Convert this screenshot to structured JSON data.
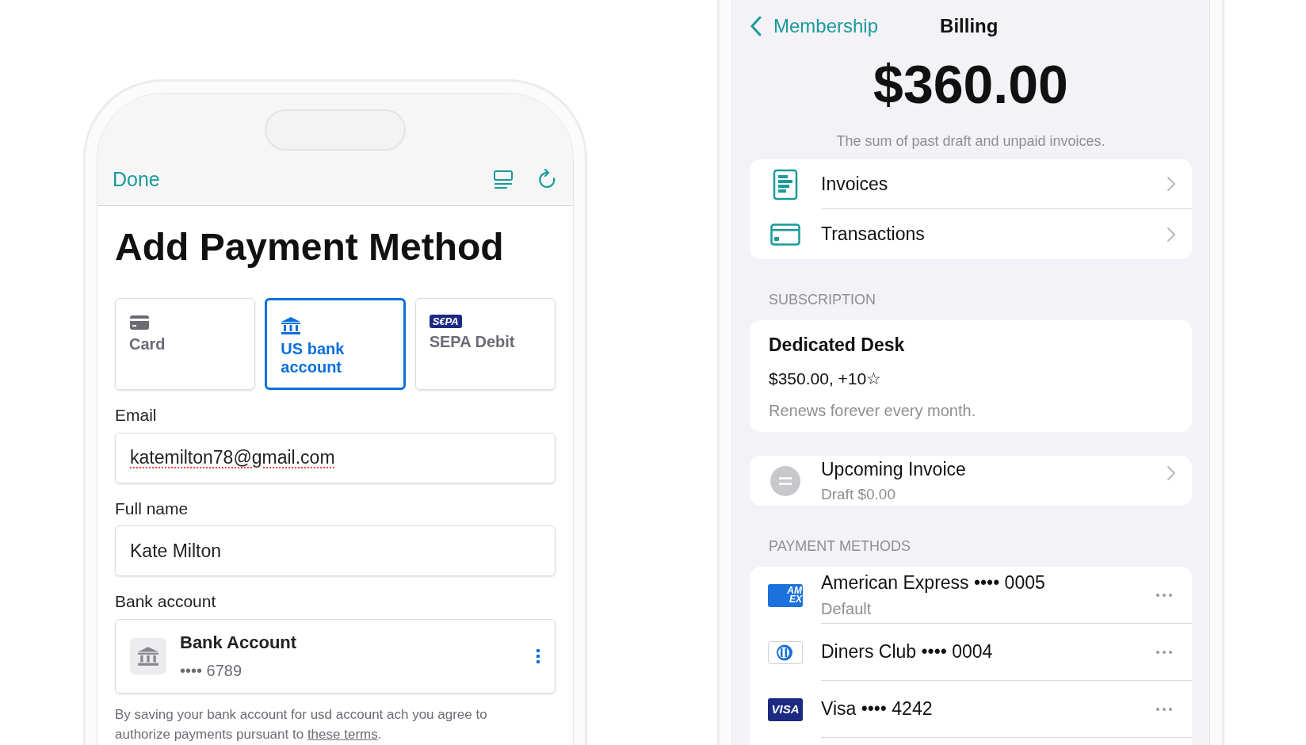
{
  "add_payment": {
    "done": "Done",
    "title": "Add Payment Method",
    "methods": [
      {
        "kind": "card",
        "label": "Card",
        "selected": false
      },
      {
        "kind": "bank",
        "label": "US bank account",
        "selected": true
      },
      {
        "kind": "sepa",
        "label": "SEPA Debit",
        "logo": "S€PA",
        "selected": false
      }
    ],
    "email": {
      "label": "Email",
      "value": "katemilton78@gmail.com",
      "misspelled": true
    },
    "full_name": {
      "label": "Full name",
      "value": "Kate Milton"
    },
    "bank_account": {
      "label": "Bank account",
      "title": "Bank Account",
      "number": "•••• 6789"
    },
    "terms": {
      "text": "By saving your bank account for usd account ach you agree to authorize payments pursuant to",
      "link": "these terms",
      "end": "."
    }
  },
  "billing": {
    "back": "Membership",
    "title": "Billing",
    "amount": "$360.00",
    "caption": "The sum of past draft and unpaid invoices.",
    "links": [
      {
        "kind": "invoice",
        "label": "Invoices"
      },
      {
        "kind": "card",
        "label": "Transactions"
      }
    ],
    "subscription": {
      "header": "SUBSCRIPTION",
      "name": "Dedicated Desk",
      "price": "$350.00, +10☆",
      "renews": "Renews forever every month."
    },
    "upcoming": {
      "title": "Upcoming Invoice",
      "subtitle": "Draft $0.00"
    },
    "payment_methods": {
      "header": "PAYMENT METHODS",
      "items": [
        {
          "kind": "amex",
          "logo_lines": [
            "AM",
            "EX"
          ],
          "label": "American Express •••• 0005",
          "sub": "Default"
        },
        {
          "kind": "diners",
          "label": "Diners Club •••• 0004"
        },
        {
          "kind": "visa",
          "logo": "VISA",
          "label": "Visa •••• 4242"
        }
      ]
    }
  }
}
